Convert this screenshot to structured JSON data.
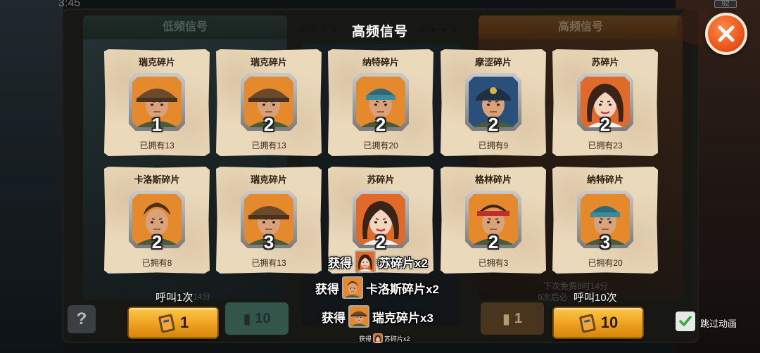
{
  "status": {
    "time": "3:45",
    "battery": "92"
  },
  "background": {
    "tab_left": "低频信号",
    "tab_right": "高频信号",
    "next_free_text": "下次免费8时14分",
    "guarantee_text": "9次后必",
    "timer_partial": "时14分"
  },
  "overlay": {
    "title": "高频信号",
    "title_decor": "● ● ● ●"
  },
  "cards": [
    {
      "name": "瑞克碎片",
      "count": "1",
      "owned": "已拥有13",
      "portrait": "rick",
      "frame": "#f0a030"
    },
    {
      "name": "瑞克碎片",
      "count": "2",
      "owned": "已拥有13",
      "portrait": "rick",
      "frame": "#f0a030"
    },
    {
      "name": "纳特碎片",
      "count": "2",
      "owned": "已拥有20",
      "portrait": "nate",
      "frame": "#f0a030"
    },
    {
      "name": "摩涩碎片",
      "count": "2",
      "owned": "已拥有9",
      "portrait": "mose",
      "frame": "#f0a030"
    },
    {
      "name": "苏碎片",
      "count": "2",
      "owned": "已拥有23",
      "portrait": "su",
      "frame": "#f0a030"
    },
    {
      "name": "卡洛斯碎片",
      "count": "2",
      "owned": "已拥有8",
      "portrait": "carlos",
      "frame": "#f0a030"
    },
    {
      "name": "瑞克碎片",
      "count": "3",
      "owned": "已拥有13",
      "portrait": "rick",
      "frame": "#f0a030"
    },
    {
      "name": "苏碎片",
      "count": "2",
      "owned": "已拥有23",
      "portrait": "su",
      "frame": "#f0a030"
    },
    {
      "name": "格林碎片",
      "count": "2",
      "owned": "已拥有3",
      "portrait": "green",
      "frame": "#f0a030"
    },
    {
      "name": "纳特碎片",
      "count": "3",
      "owned": "已拥有20",
      "portrait": "nate",
      "frame": "#f0a030"
    }
  ],
  "buttons": {
    "call_once_label": "呼叫1次",
    "call_once_cost": "1",
    "call_ten_label": "呼叫10次",
    "call_ten_cost": "10",
    "ghost_left_cost": "10",
    "ghost_right_cost": "1",
    "help": "?"
  },
  "gains": {
    "prefix": "获得",
    "items": [
      "苏碎片x2",
      "卡洛斯碎片x2",
      "瑞克碎片x3"
    ],
    "small_item": "苏碎片x2"
  },
  "skip": {
    "label": "跳过动画",
    "checked": true
  },
  "colors": {
    "accent_orange": "#f05a1e",
    "button_gold": "#f0a020",
    "card_bg": "#ead9bb",
    "check_green": "#2fae3a"
  }
}
